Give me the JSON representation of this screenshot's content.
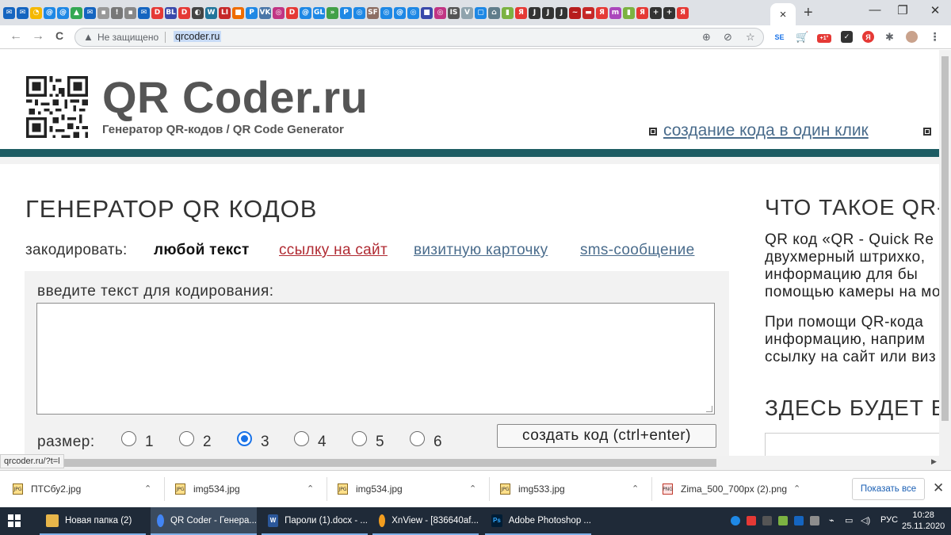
{
  "browser": {
    "active_tab_close": "×",
    "new_tab": "+",
    "window_controls": [
      "—",
      "❐",
      "✕"
    ],
    "nav": {
      "back": "←",
      "forward": "→",
      "reload": "C"
    },
    "address": {
      "security_text": "Не защищено",
      "url": "qrcoder.ru"
    },
    "status_url": "qrcoder.ru/?t=l",
    "extension_badge": "+1°"
  },
  "site": {
    "logo_title": "QR Coder.ru",
    "logo_subtitle": "Генератор QR-кодов / QR Code Generator",
    "header_link": "создание кода в один клик",
    "main_title": "ГЕНЕРАТОР QR КОДОВ",
    "encode": {
      "label": "закодировать:",
      "active": "любой текст",
      "options": [
        "ссылку на сайт",
        "визитную карточку",
        "sms-сообщение"
      ]
    },
    "input_label": "введите текст для кодирования:",
    "size_label": "размер:",
    "sizes": [
      "1",
      "2",
      "3",
      "4",
      "5",
      "6"
    ],
    "selected_size": "3",
    "generate_button": "создать код (ctrl+enter)",
    "sidebar": {
      "title": "ЧТО ТАКОЕ QR-К",
      "para1": [
        "QR код «QR - Quick Re",
        "двухмерный штрихко,",
        "информацию для бы",
        "помощью камеры на мо"
      ],
      "para2": [
        "При помощи QR-кода",
        "информацию, наприм",
        "ссылку на сайт или виз"
      ],
      "title2": "ЗДЕСЬ БУДЕТ ВА"
    }
  },
  "downloads": {
    "items": [
      {
        "name": "ПТСбу2.jpg",
        "type": "jpg"
      },
      {
        "name": "img534.jpg",
        "type": "jpg"
      },
      {
        "name": "img534.jpg",
        "type": "jpg"
      },
      {
        "name": "img533.jpg",
        "type": "jpg"
      },
      {
        "name": "Zima_500_700px (2).png",
        "type": "png"
      }
    ],
    "show_all": "Показать все",
    "close": "✕"
  },
  "taskbar": {
    "tasks": [
      {
        "label": "Новая папка (2)",
        "color": "#e8b64a"
      },
      {
        "label": "QR Coder - Генера...",
        "color": "#4285f4"
      },
      {
        "label": "Пароли (1).docx - ...",
        "color": "#2b579a"
      },
      {
        "label": "XnView - [836640af...",
        "color": "#f29d1f"
      },
      {
        "label": "Adobe Photoshop ...",
        "color": "#001d35"
      }
    ],
    "language": "РУС",
    "time": "10:28",
    "date": "25.11.2020"
  },
  "colors": {
    "header_bar": "#1d5c63",
    "link": "#4a6c8c",
    "link_visited": "#b02a32",
    "radio_checked": "#1a73e8"
  }
}
